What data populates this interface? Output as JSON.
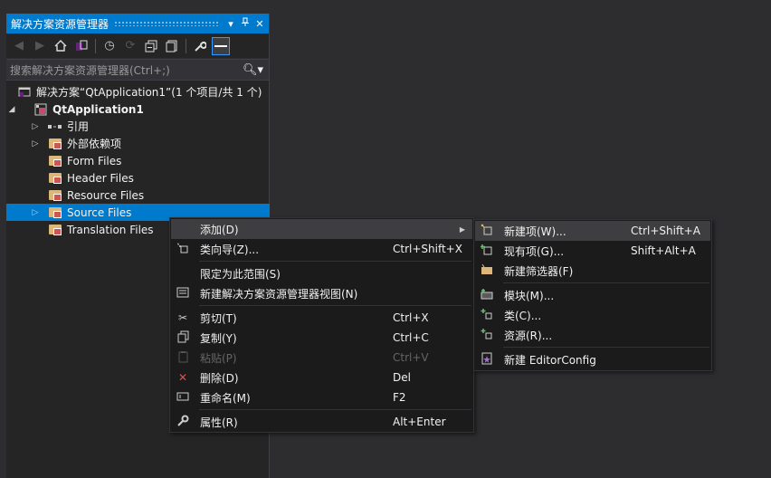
{
  "panel": {
    "title": "解决方案资源管理器",
    "pin_glyph": "▾",
    "pin2_glyph": "⊣",
    "close_glyph": "✕",
    "search_placeholder": "搜索解决方案资源管理器(Ctrl+;)"
  },
  "tree": {
    "solution": "解决方案“QtApplication1”(1 个项目/共 1 个)",
    "project": "QtApplication1",
    "items": [
      {
        "label": "引用"
      },
      {
        "label": "外部依赖项"
      },
      {
        "label": "Form Files"
      },
      {
        "label": "Header Files"
      },
      {
        "label": "Resource Files"
      },
      {
        "label": "Source Files"
      },
      {
        "label": "Translation Files"
      }
    ]
  },
  "context_menu": {
    "items": [
      {
        "label": "添加(D)",
        "shortcut": ""
      },
      {
        "label": "类向导(Z)...",
        "shortcut": "Ctrl+Shift+X"
      },
      {
        "label": "限定为此范围(S)",
        "shortcut": ""
      },
      {
        "label": "新建解决方案资源管理器视图(N)",
        "shortcut": ""
      },
      {
        "label": "剪切(T)",
        "shortcut": "Ctrl+X"
      },
      {
        "label": "复制(Y)",
        "shortcut": "Ctrl+C"
      },
      {
        "label": "粘贴(P)",
        "shortcut": "Ctrl+V"
      },
      {
        "label": "删除(D)",
        "shortcut": "Del"
      },
      {
        "label": "重命名(M)",
        "shortcut": "F2"
      },
      {
        "label": "属性(R)",
        "shortcut": "Alt+Enter"
      }
    ]
  },
  "submenu": {
    "items": [
      {
        "label": "新建项(W)...",
        "shortcut": "Ctrl+Shift+A"
      },
      {
        "label": "现有项(G)...",
        "shortcut": "Shift+Alt+A"
      },
      {
        "label": "新建筛选器(F)",
        "shortcut": ""
      },
      {
        "label": "模块(M)...",
        "shortcut": ""
      },
      {
        "label": "类(C)...",
        "shortcut": ""
      },
      {
        "label": "资源(R)...",
        "shortcut": ""
      },
      {
        "label": "新建 EditorConfig",
        "shortcut": ""
      }
    ]
  },
  "colors": {
    "accent": "#007acc",
    "background": "#2d2d30",
    "panel": "#252526",
    "menu": "#1b1b1c"
  }
}
